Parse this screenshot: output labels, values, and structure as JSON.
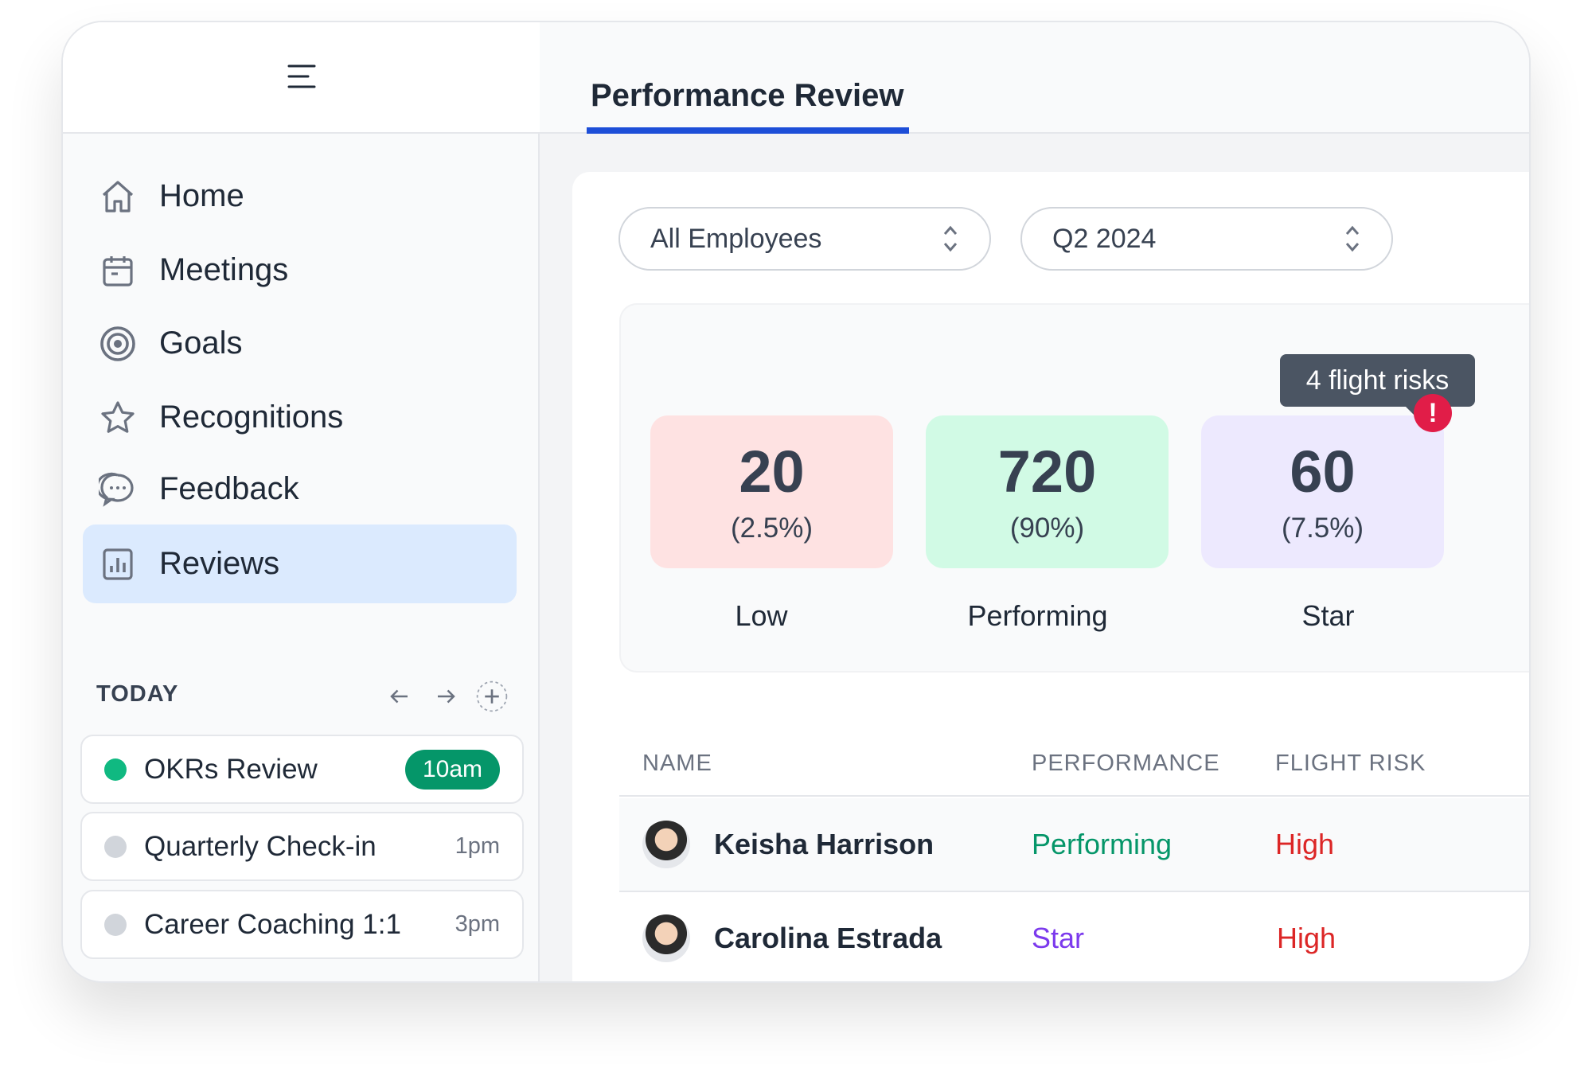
{
  "sidebar": {
    "menu_icon": "hamburger-icon",
    "items": [
      {
        "label": "Home",
        "icon": "home-icon"
      },
      {
        "label": "Meetings",
        "icon": "calendar-icon"
      },
      {
        "label": "Goals",
        "icon": "target-icon"
      },
      {
        "label": "Recognitions",
        "icon": "star-icon"
      },
      {
        "label": "Feedback",
        "icon": "chat-icon"
      },
      {
        "label": "Reviews",
        "icon": "bar-chart-icon",
        "active": true
      }
    ],
    "today": {
      "title": "TODAY",
      "events": [
        {
          "title": "OKRs Review",
          "time": "10am",
          "status_color": "#10b981",
          "current": true
        },
        {
          "title": "Quarterly Check-in",
          "time": "1pm",
          "status_color": "#d1d5db"
        },
        {
          "title": "Career Coaching 1:1",
          "time": "3pm",
          "status_color": "#d1d5db"
        }
      ]
    }
  },
  "main": {
    "tab": "Performance Review",
    "filters": {
      "employees": "All Employees",
      "period": "Q2 2024"
    },
    "tooltip": "4 flight risks",
    "stats": [
      {
        "value": "20",
        "percent": "(2.5%)",
        "label": "Low",
        "color": "#fee2e2"
      },
      {
        "value": "720",
        "percent": "(90%)",
        "label": "Performing",
        "color": "#d1fae5"
      },
      {
        "value": "60",
        "percent": "(7.5%)",
        "label": "Star",
        "color": "#ede9fe"
      }
    ],
    "table": {
      "headers": [
        "NAME",
        "PERFORMANCE",
        "FLIGHT RISK"
      ],
      "rows": [
        {
          "name": "Keisha Harrison",
          "performance": "Performing",
          "performance_color": "#059669",
          "flight_risk": "High",
          "risk_color": "#dc2626"
        },
        {
          "name": "Carolina Estrada",
          "performance": "Star",
          "performance_color": "#7c3aed",
          "flight_risk": "High",
          "risk_color": "#dc2626"
        }
      ]
    }
  }
}
